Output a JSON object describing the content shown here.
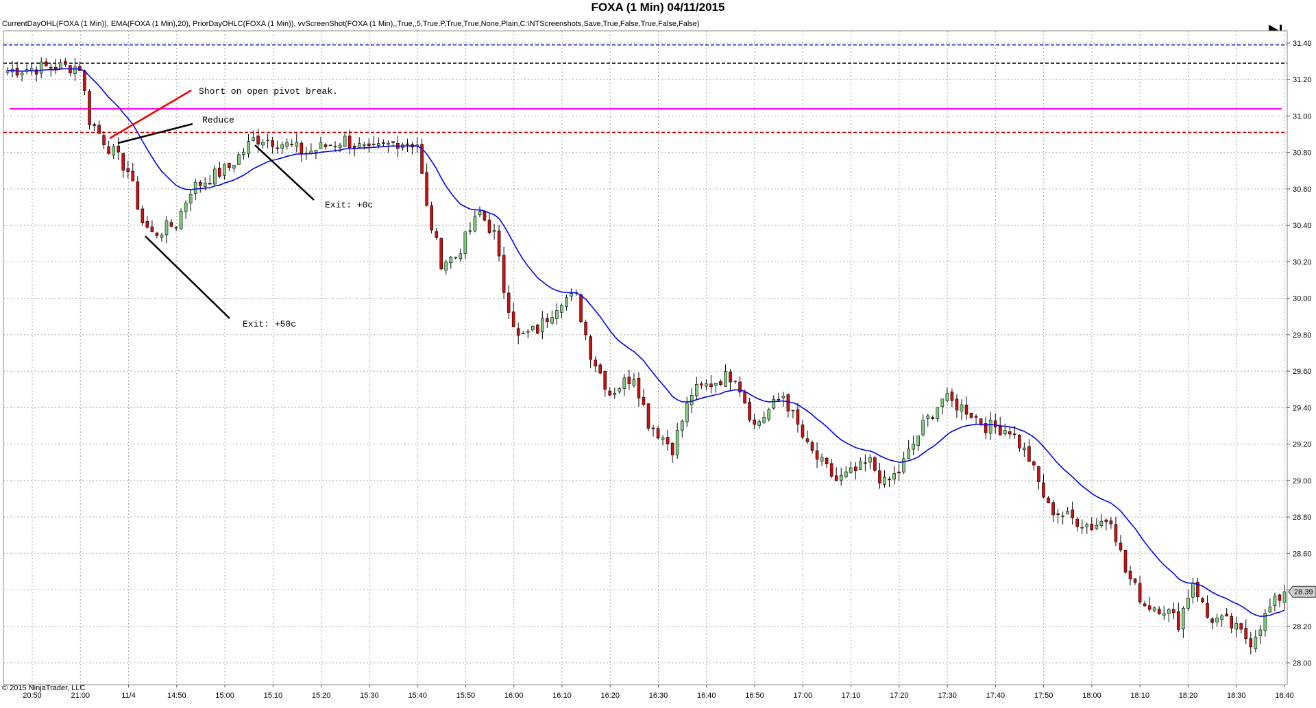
{
  "title": "FOXA (1 Min) 04/11/2015",
  "indicators_text": "CurrentDayOHL(FOXA (1 Min)), EMA(FOXA (1 Min),20), PriorDayOHLC(FOXA (1 Min)), vvScreenShot(FOXA (1 Min),,True,,5,True,P,True,True,None,Plain,C:\\NTScreenshots,Save,True,False,True,False,False)",
  "copyright": "© 2015 NinjaTrader, LLC",
  "play_icon": "skip-to-end-icon",
  "chart_data": {
    "type": "candlestick",
    "x_tick_labels": [
      "20:50",
      "21:00",
      "11/4",
      "14:50",
      "15:00",
      "15:10",
      "15:20",
      "15:30",
      "15:40",
      "15:50",
      "16:00",
      "16:10",
      "16:20",
      "16:30",
      "16:40",
      "16:50",
      "17:00",
      "17:10",
      "17:20",
      "17:30",
      "17:40",
      "17:50",
      "18:00",
      "18:10",
      "18:20",
      "18:30",
      "18:40"
    ],
    "y_tick_labels": [
      "31.40",
      "31.20",
      "31.00",
      "30.80",
      "30.60",
      "30.40",
      "30.20",
      "30.00",
      "29.80",
      "29.60",
      "29.40",
      "29.20",
      "29.00",
      "28.80",
      "28.60",
      "28.40",
      "28.20",
      "28.00"
    ],
    "ylim": [
      27.95,
      31.48
    ],
    "grid": true,
    "last_price_label": "28.39",
    "bar_count": 266,
    "price_anchors": [
      [
        0,
        31.25
      ],
      [
        9,
        31.27
      ],
      [
        15,
        31.27
      ],
      [
        17,
        30.98
      ],
      [
        21,
        30.83
      ],
      [
        25,
        30.7
      ],
      [
        28,
        30.42
      ],
      [
        30,
        30.35
      ],
      [
        35,
        30.41
      ],
      [
        38,
        30.6
      ],
      [
        46,
        30.72
      ],
      [
        51,
        30.87
      ],
      [
        53,
        30.88
      ],
      [
        57,
        30.85
      ],
      [
        62,
        30.8
      ],
      [
        70,
        30.87
      ],
      [
        75,
        30.8
      ],
      [
        81,
        30.86
      ],
      [
        85,
        30.85
      ],
      [
        87,
        30.49
      ],
      [
        90,
        30.2
      ],
      [
        93,
        30.23
      ],
      [
        97,
        30.42
      ],
      [
        98,
        30.47
      ],
      [
        101,
        30.35
      ],
      [
        103,
        30.05
      ],
      [
        106,
        29.78
      ],
      [
        110,
        29.83
      ],
      [
        115,
        30.0
      ],
      [
        118,
        30.0
      ],
      [
        121,
        29.7
      ],
      [
        125,
        29.48
      ],
      [
        130,
        29.58
      ],
      [
        133,
        29.32
      ],
      [
        138,
        29.18
      ],
      [
        142,
        29.48
      ],
      [
        148,
        29.56
      ],
      [
        151,
        29.58
      ],
      [
        155,
        29.3
      ],
      [
        161,
        29.47
      ],
      [
        166,
        29.18
      ],
      [
        172,
        29.0
      ],
      [
        176,
        29.05
      ],
      [
        179,
        29.1
      ],
      [
        182,
        28.98
      ],
      [
        185,
        29.05
      ],
      [
        190,
        29.3
      ],
      [
        194,
        29.45
      ],
      [
        199,
        29.39
      ],
      [
        203,
        29.3
      ],
      [
        208,
        29.28
      ],
      [
        212,
        29.12
      ],
      [
        216,
        28.85
      ],
      [
        220,
        28.8
      ],
      [
        225,
        28.75
      ],
      [
        229,
        28.8
      ],
      [
        232,
        28.5
      ],
      [
        236,
        28.32
      ],
      [
        240,
        28.3
      ],
      [
        243,
        28.22
      ],
      [
        246,
        28.45
      ],
      [
        249,
        28.25
      ],
      [
        253,
        28.22
      ],
      [
        258,
        28.12
      ],
      [
        262,
        28.3
      ],
      [
        265,
        28.39
      ]
    ],
    "ema_period": 20,
    "levels": [
      {
        "name": "prior-day-high",
        "value": 31.39,
        "color": "#0000cc",
        "style": "dashed"
      },
      {
        "name": "current-day-open",
        "value": 31.29,
        "color": "#000000",
        "style": "dashed"
      },
      {
        "name": "pivot",
        "value": 31.04,
        "color": "#ff00ff",
        "style": "solid"
      },
      {
        "name": "prior-day-low",
        "value": 30.91,
        "color": "#dd0000",
        "style": "dashed"
      }
    ],
    "annotations": [
      {
        "label": "Short on open pivot break.",
        "line_color": "#ee0000"
      },
      {
        "label": "Reduce",
        "line_color": "#000000"
      },
      {
        "label": "Exit: +0c",
        "line_color": "#000000"
      },
      {
        "label": "Exit: +50c",
        "line_color": "#000000"
      }
    ],
    "colors": {
      "up": "#7fcf7f",
      "down": "#cc1111",
      "wick": "#000000",
      "ema": "#0000ee",
      "grid": "#a8a8a8",
      "last_price_bg": "#d0d0d0"
    }
  }
}
